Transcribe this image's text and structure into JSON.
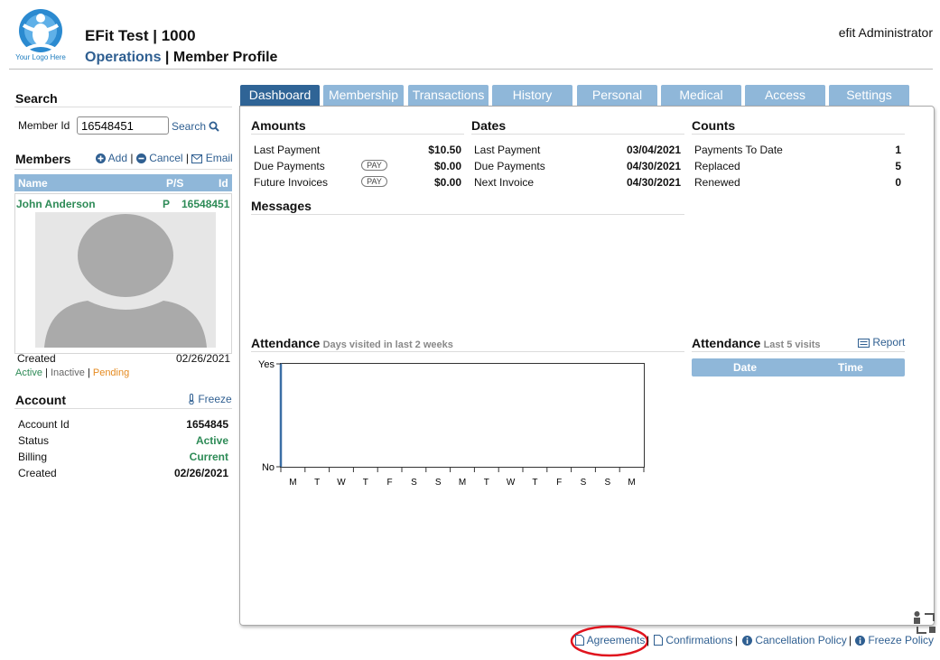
{
  "header": {
    "logo_text": "Your Logo Here",
    "club_title": "EFit Test | 1000",
    "breadcrumb_section": "Operations",
    "breadcrumb_separator": "|",
    "breadcrumb_page": "Member Profile",
    "user": "efit Administrator"
  },
  "search": {
    "heading": "Search",
    "member_id_label": "Member Id",
    "member_id_value": "16548451",
    "search_label": "Search"
  },
  "members": {
    "heading": "Members",
    "add_label": "Add",
    "cancel_label": "Cancel",
    "email_label": "Email",
    "columns": [
      "Name",
      "P/S",
      "Id"
    ],
    "row": {
      "name": "John Anderson",
      "ps": "P",
      "id": "16548451"
    },
    "created_label": "Created",
    "created_value": "02/26/2021",
    "status_active": "Active",
    "status_inactive": "Inactive",
    "status_pending": "Pending"
  },
  "account": {
    "heading": "Account",
    "freeze_label": "Freeze",
    "rows": [
      {
        "label": "Account Id",
        "value": "1654845"
      },
      {
        "label": "Status",
        "value": "Active"
      },
      {
        "label": "Billing",
        "value": "Current"
      },
      {
        "label": "Created",
        "value": "02/26/2021"
      }
    ]
  },
  "tabs": [
    "Dashboard",
    "Membership",
    "Transactions",
    "History",
    "Personal",
    "Medical",
    "Access",
    "Settings"
  ],
  "amounts": {
    "heading": "Amounts",
    "pay_label": "PAY",
    "rows": [
      {
        "label": "Last Payment",
        "value": "$10.50"
      },
      {
        "label": "Due Payments",
        "value": "$0.00"
      },
      {
        "label": "Future Invoices",
        "value": "$0.00"
      }
    ]
  },
  "dates": {
    "heading": "Dates",
    "rows": [
      {
        "label": "Last Payment",
        "value": "03/04/2021"
      },
      {
        "label": "Due Payments",
        "value": "04/30/2021"
      },
      {
        "label": "Next Invoice",
        "value": "04/30/2021"
      }
    ]
  },
  "counts": {
    "heading": "Counts",
    "rows": [
      {
        "label": "Payments To Date",
        "value": "1"
      },
      {
        "label": "Replaced",
        "value": "5"
      },
      {
        "label": "Renewed",
        "value": "0"
      }
    ]
  },
  "messages": {
    "heading": "Messages"
  },
  "attendance_chart": {
    "heading": "Attendance",
    "subnote": "Days visited in last 2 weeks",
    "y_top": "Yes",
    "y_bottom": "No"
  },
  "attendance_list": {
    "heading": "Attendance",
    "subnote": "Last 5 visits",
    "report_label": "Report",
    "columns": [
      "Date",
      "Time"
    ]
  },
  "chart_data": {
    "type": "bar",
    "categories": [
      "M",
      "T",
      "W",
      "T",
      "F",
      "S",
      "S",
      "M",
      "T",
      "W",
      "T",
      "F",
      "S",
      "S",
      "M"
    ],
    "values": [
      0,
      0,
      0,
      0,
      0,
      0,
      0,
      0,
      0,
      0,
      0,
      0,
      0,
      0,
      0
    ],
    "title": "Attendance",
    "subtitle": "Days visited in last 2 weeks",
    "y_tick_labels": [
      "No",
      "Yes"
    ],
    "grid": false
  },
  "footer": {
    "agreements": "Agreements",
    "confirmations": "Confirmations",
    "cancellation": "Cancellation Policy",
    "freeze": "Freeze Policy",
    "separator": "|"
  },
  "colors": {
    "accent": "#2f6496",
    "tab": "#8fb7d9",
    "link": "#2f5f91",
    "active": "#2e8b57",
    "pending": "#e58a1f",
    "highlight_circle": "#e0141e"
  }
}
